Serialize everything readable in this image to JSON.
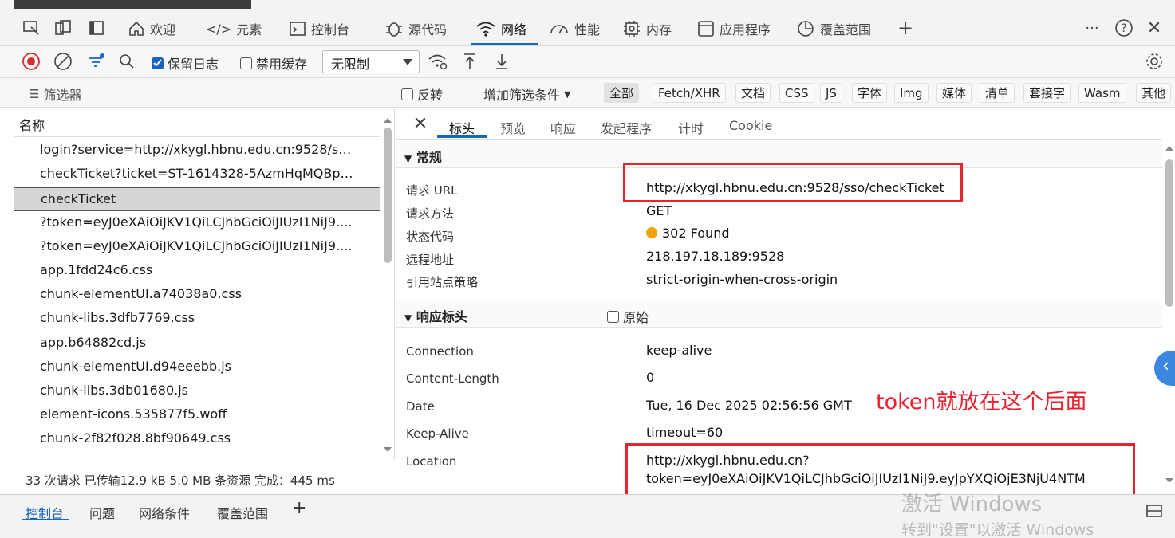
{
  "tabs": [
    {
      "label": "欢迎",
      "icon": "home-icon"
    },
    {
      "label": "元素",
      "icon": "code-icon"
    },
    {
      "label": "控制台",
      "icon": "console-icon"
    },
    {
      "label": "源代码",
      "icon": "bug-icon"
    },
    {
      "label": "网络",
      "icon": "wifi-icon"
    },
    {
      "label": "性能",
      "icon": "performance-icon"
    },
    {
      "label": "内存",
      "icon": "memory-icon"
    },
    {
      "label": "应用程序",
      "icon": "application-icon"
    },
    {
      "label": "覆盖范围",
      "icon": "coverage-icon"
    }
  ],
  "toolbar": {
    "preserve_log": "保留日志",
    "disable_cache": "禁用缓存",
    "throttle": "无限制"
  },
  "filter": {
    "placeholder": "筛选器",
    "invert": "反转",
    "more_filters": "增加筛选条件",
    "types": [
      "全部",
      "Fetch/XHR",
      "文档",
      "CSS",
      "JS",
      "字体",
      "Img",
      "媒体",
      "清单",
      "套接字",
      "Wasm",
      "其他"
    ]
  },
  "list": {
    "header": "名称",
    "items": [
      "login?service=http://xkygl.hbnu.edu.cn:9528/sso...",
      "checkTicket?ticket=ST-1614328-5AzmHqMQBpB...",
      "checkTicket",
      "?token=eyJ0eXAiOiJKV1QiLCJhbGciOiJIUzI1NiJ9....",
      "?token=eyJ0eXAiOiJKV1QiLCJhbGciOiJIUzI1NiJ9....",
      "app.1fdd24c6.css",
      "chunk-elementUI.a74038a0.css",
      "chunk-libs.3dfb7769.css",
      "app.b64882cd.js",
      "chunk-elementUI.d94eeebb.js",
      "chunk-libs.3db01680.js",
      "element-icons.535877f5.woff",
      "chunk-2f82f028.8bf90649.css"
    ],
    "status": "33 次请求  已传输12.9 kB  5.0 MB 条资源  完成：445 ms"
  },
  "detail_tabs": [
    "标头",
    "预览",
    "响应",
    "发起程序",
    "计时",
    "Cookie"
  ],
  "general": {
    "title": "常规",
    "rows": [
      {
        "k": "请求 URL",
        "v": "http://xkygl.hbnu.edu.cn:9528/sso/checkTicket"
      },
      {
        "k": "请求方法",
        "v": "GET"
      },
      {
        "k": "状态代码",
        "v": "302 Found"
      },
      {
        "k": "远程地址",
        "v": "218.197.18.189:9528"
      },
      {
        "k": "引用站点策略",
        "v": "strict-origin-when-cross-origin"
      }
    ]
  },
  "response_headers": {
    "title": "响应标头",
    "raw": "原始",
    "rows": [
      {
        "k": "Connection",
        "v": "keep-alive"
      },
      {
        "k": "Content-Length",
        "v": "0"
      },
      {
        "k": "Date",
        "v": "Tue, 16 Dec 2025 02:56:56 GMT"
      },
      {
        "k": "Keep-Alive",
        "v": "timeout=60"
      },
      {
        "k": "Location",
        "v": "http://xkygl.hbnu.edu.cn?",
        "v2": "token=eyJ0eXAiOiJKV1QiLCJhbGciOiJIUzI1NiJ9.eyJpYXQiOjE3NjU4NTM"
      }
    ]
  },
  "annotation": "token就放在这个后面",
  "drawer": {
    "tabs": [
      "控制台",
      "问题",
      "网络条件",
      "覆盖范围"
    ]
  },
  "watermark": {
    "line1": "激活 Windows",
    "line2": "转到\"设置\"以激活 Windows"
  },
  "colors": {
    "accent": "#0f6cbd",
    "annotation": "#e8222f",
    "status_dot": "#f0a30a"
  }
}
